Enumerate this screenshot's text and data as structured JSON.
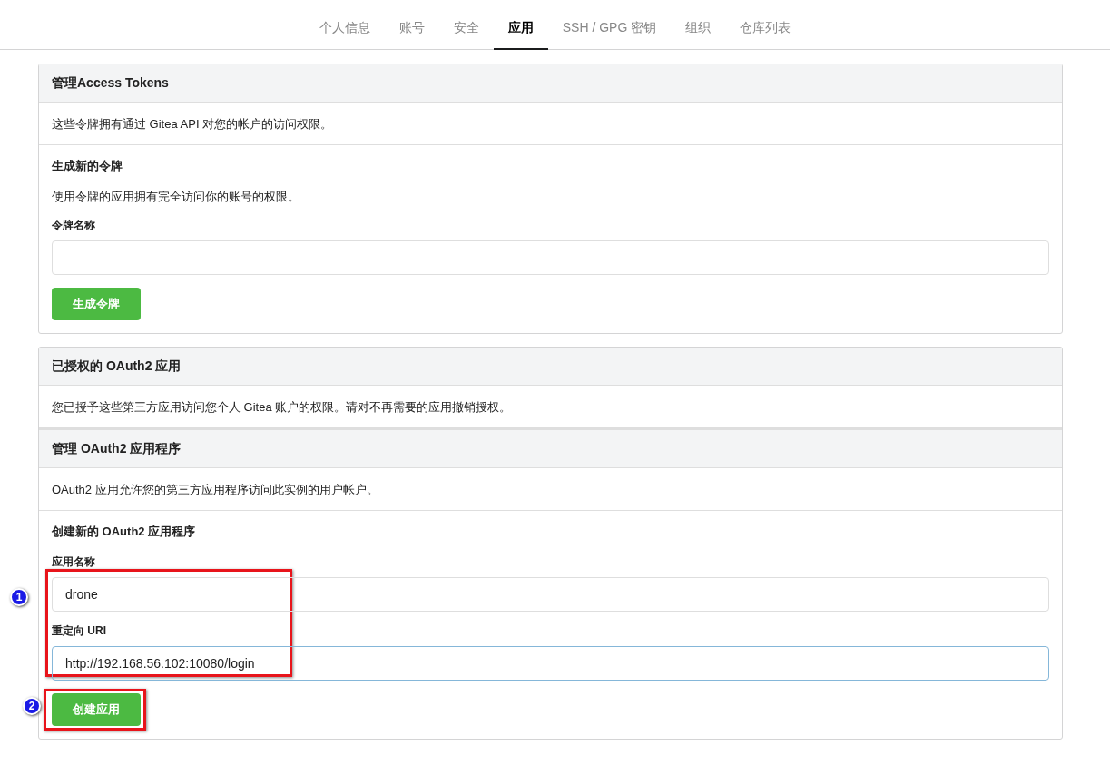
{
  "tabs": [
    {
      "label": "个人信息",
      "selected": false
    },
    {
      "label": "账号",
      "selected": false
    },
    {
      "label": "安全",
      "selected": false
    },
    {
      "label": "应用",
      "selected": true
    },
    {
      "label": "SSH / GPG 密钥",
      "selected": false
    },
    {
      "label": "组织",
      "selected": false
    },
    {
      "label": "仓库列表",
      "selected": false
    }
  ],
  "access_tokens": {
    "header": "管理Access Tokens",
    "description": "这些令牌拥有通过 Gitea API 对您的帐户的访问权限。",
    "form_title": "生成新的令牌",
    "form_hint": "使用令牌的应用拥有完全访问你的账号的权限。",
    "field_label": "令牌名称",
    "button": "生成令牌"
  },
  "authorized_oauth2": {
    "header": "已授权的 OAuth2 应用",
    "description": "您已授予这些第三方应用访问您个人 Gitea 账户的权限。请对不再需要的应用撤销授权。"
  },
  "manage_oauth2": {
    "header": "管理 OAuth2 应用程序",
    "description": "OAuth2 应用允许您的第三方应用程序访问此实例的用户帐户。",
    "form_title": "创建新的 OAuth2 应用程序",
    "fields": [
      {
        "label": "应用名称",
        "value": "drone",
        "focused": false
      },
      {
        "label": "重定向 URI",
        "value": "http://192.168.56.102:10080/login",
        "focused": true
      }
    ],
    "button": "创建应用"
  },
  "annotations": [
    {
      "number": "1"
    },
    {
      "number": "2"
    }
  ]
}
